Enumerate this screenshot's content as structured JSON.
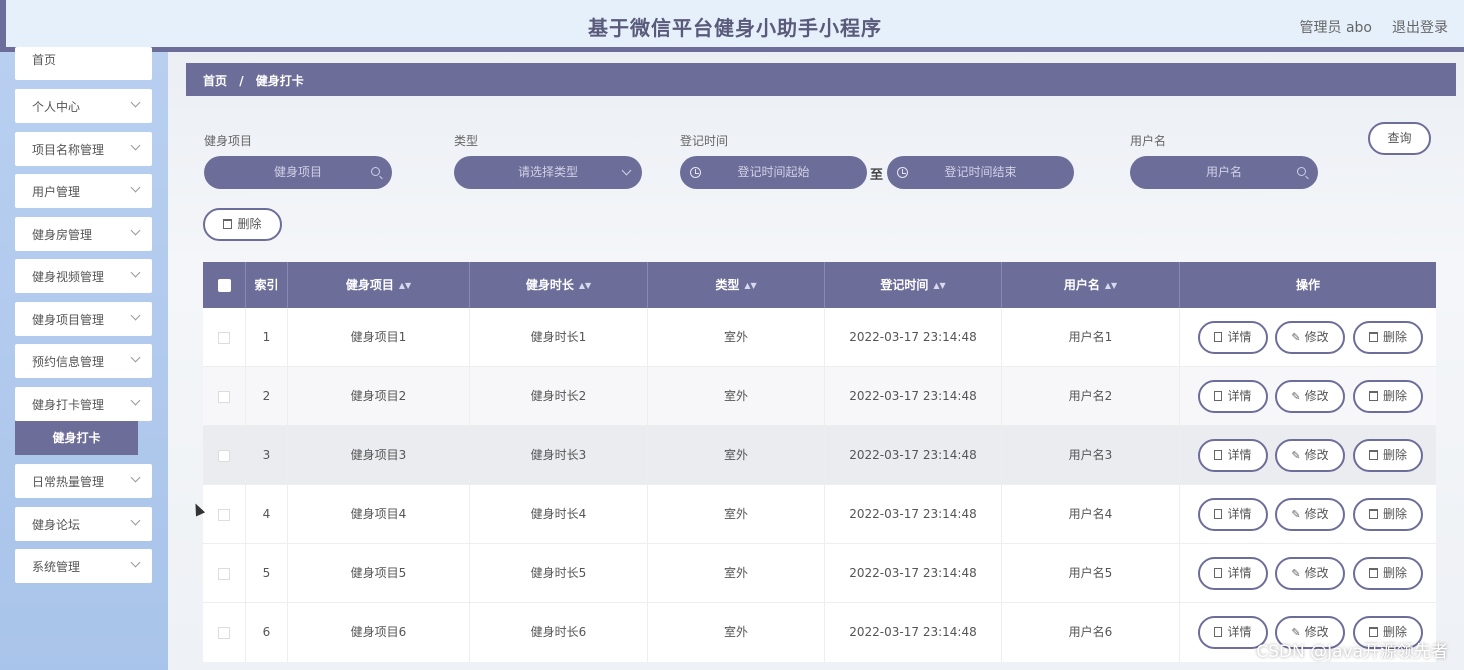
{
  "header": {
    "title": "基于微信平台健身小助手小程序",
    "admin": "管理员 abo",
    "logout": "退出登录"
  },
  "sidebar": {
    "items": [
      {
        "label": "首页"
      },
      {
        "label": "个人中心"
      },
      {
        "label": "项目名称管理"
      },
      {
        "label": "用户管理"
      },
      {
        "label": "健身房管理"
      },
      {
        "label": "健身视频管理"
      },
      {
        "label": "健身项目管理"
      },
      {
        "label": "预约信息管理"
      },
      {
        "label": "健身打卡管理"
      },
      {
        "label": "日常热量管理"
      },
      {
        "label": "健身论坛"
      },
      {
        "label": "系统管理"
      }
    ],
    "active_sub": "健身打卡"
  },
  "breadcrumb": {
    "home": "首页",
    "sep": "/",
    "current": "健身打卡"
  },
  "search": {
    "project_label": "健身项目",
    "project_placeholder": "健身项目",
    "type_label": "类型",
    "type_placeholder": "请选择类型",
    "time_label": "登记时间",
    "time_start_placeholder": "登记时间起始",
    "time_to": "至",
    "time_end_placeholder": "登记时间结束",
    "user_label": "用户名",
    "user_placeholder": "用户名",
    "query_button": "查询",
    "delete_button": "删除"
  },
  "table": {
    "columns": [
      "索引",
      "健身项目",
      "健身时长",
      "类型",
      "登记时间",
      "用户名",
      "操作"
    ],
    "rows": [
      {
        "index": "1",
        "project": "健身项目1",
        "duration": "健身时长1",
        "type": "室外",
        "time": "2022-03-17 23:14:48",
        "user": "用户名1"
      },
      {
        "index": "2",
        "project": "健身项目2",
        "duration": "健身时长2",
        "type": "室外",
        "time": "2022-03-17 23:14:48",
        "user": "用户名2"
      },
      {
        "index": "3",
        "project": "健身项目3",
        "duration": "健身时长3",
        "type": "室外",
        "time": "2022-03-17 23:14:48",
        "user": "用户名3"
      },
      {
        "index": "4",
        "project": "健身项目4",
        "duration": "健身时长4",
        "type": "室外",
        "time": "2022-03-17 23:14:48",
        "user": "用户名4"
      },
      {
        "index": "5",
        "project": "健身项目5",
        "duration": "健身时长5",
        "type": "室外",
        "time": "2022-03-17 23:14:48",
        "user": "用户名5"
      },
      {
        "index": "6",
        "project": "健身项目6",
        "duration": "健身时长6",
        "type": "室外",
        "time": "2022-03-17 23:14:48",
        "user": "用户名6"
      }
    ],
    "actions": {
      "detail": "详情",
      "edit": "修改",
      "delete": "删除"
    }
  },
  "watermark": "CSDN @Java开源领先者",
  "colors": {
    "accent": "#6d6d9a",
    "sidebar_bg": "#b8cff0",
    "header_bg": "#e6f0fb"
  }
}
